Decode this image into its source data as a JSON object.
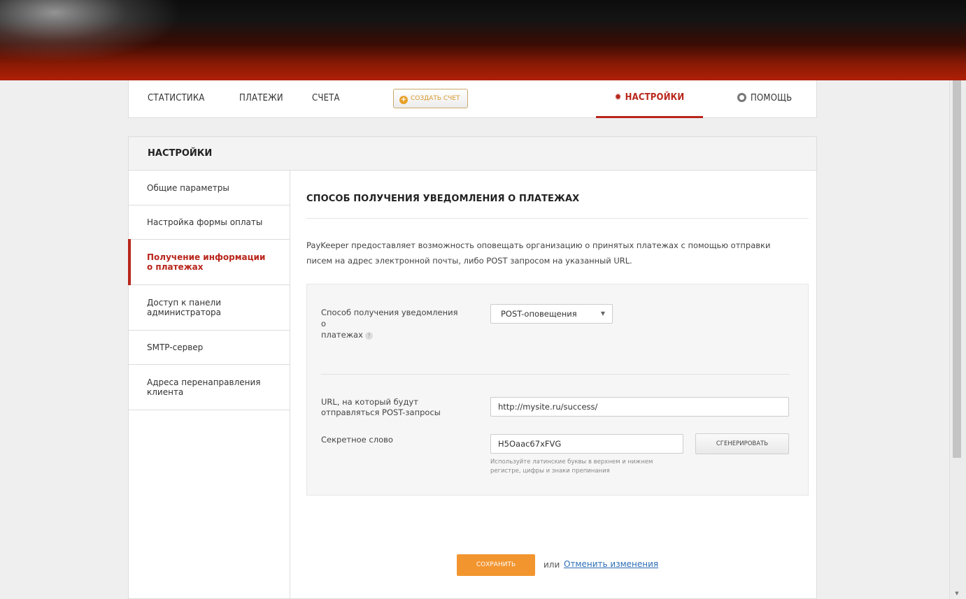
{
  "nav": {
    "stats": "СТАТИСТИКА",
    "payments": "ПЛАТЕЖИ",
    "invoices": "СЧЕТА",
    "create_invoice": "СОЗДАТЬ СЧЕТ",
    "settings": "НАСТРОЙКИ",
    "help": "ПОМОЩЬ",
    "active": "settings"
  },
  "panel": {
    "title": "НАСТРОЙКИ"
  },
  "sidebar": {
    "items": [
      {
        "label": "Общие параметры"
      },
      {
        "label": "Настройка формы оплаты"
      },
      {
        "label": "Получение информации о платежах",
        "active": true
      },
      {
        "label": "Доступ к панели администратора"
      },
      {
        "label": "SMTP-сервер"
      },
      {
        "label": "Адреса перенаправления клиента"
      }
    ]
  },
  "content": {
    "title": "СПОСОБ ПОЛУЧЕНИЯ УВЕДОМЛЕНИЯ О ПЛАТЕЖАХ",
    "description": "PayKeeper предоставляет возможность оповещать организацию о принятых платежах с помощью отправки писем на адрес электронной почты, либо POST запросом на указанный URL.",
    "form": {
      "method_label_line1": "Способ получения уведомления",
      "method_label_line2": "о",
      "method_label_line3": "платежах",
      "help_glyph": "?",
      "method_value": "POST-оповещения",
      "url_label_line1": "URL, на который будут",
      "url_label_line2": "отправляться POST-запросы",
      "url_value": "http://mysite.ru/success/",
      "secret_label": "Секретное слово",
      "secret_value": "H5Oaac67xFVG",
      "generate_label": "СГЕНЕРИРОВАТЬ",
      "hint": "Используйте латинские буквы в верхнем и нижнем регистре, цифры и знаки препинания"
    },
    "save_label": "СОХРАНИТЬ",
    "or_text": "или",
    "cancel_label": "Отменить изменения"
  },
  "colors": {
    "accent": "#b8261c",
    "save": "#f2952f",
    "link": "#2b6db5"
  }
}
